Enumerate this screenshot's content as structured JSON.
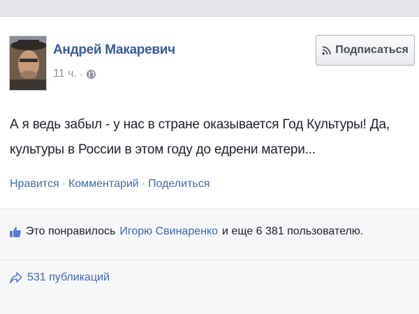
{
  "post": {
    "author": "Андрей Макаревич",
    "time": "11 ч.",
    "meta_separator": "·",
    "privacy_icon": "globe-icon",
    "subscribe_label": "Подписаться",
    "subscribe_icon": "rss-icon",
    "text_line1": "А я ведь забыл - у нас в стране оказывается Год Культуры! Да,",
    "text_line2": "культуры в России в этом году до едрени матери..."
  },
  "actions": {
    "like": "Нравится",
    "comment": "Комментарий",
    "share": "Поделиться",
    "separator": "·"
  },
  "likes": {
    "icon": "thumbs-up-icon",
    "prefix": "Это понравилось",
    "person": "Игорю Свинаренко",
    "suffix": "и еще 6 381 пользователю."
  },
  "shares": {
    "icon": "share-arrow-icon",
    "label": "531 публикаций"
  },
  "colors": {
    "link": "#4267b2",
    "author": "#3b5998",
    "muted": "#90949c"
  }
}
